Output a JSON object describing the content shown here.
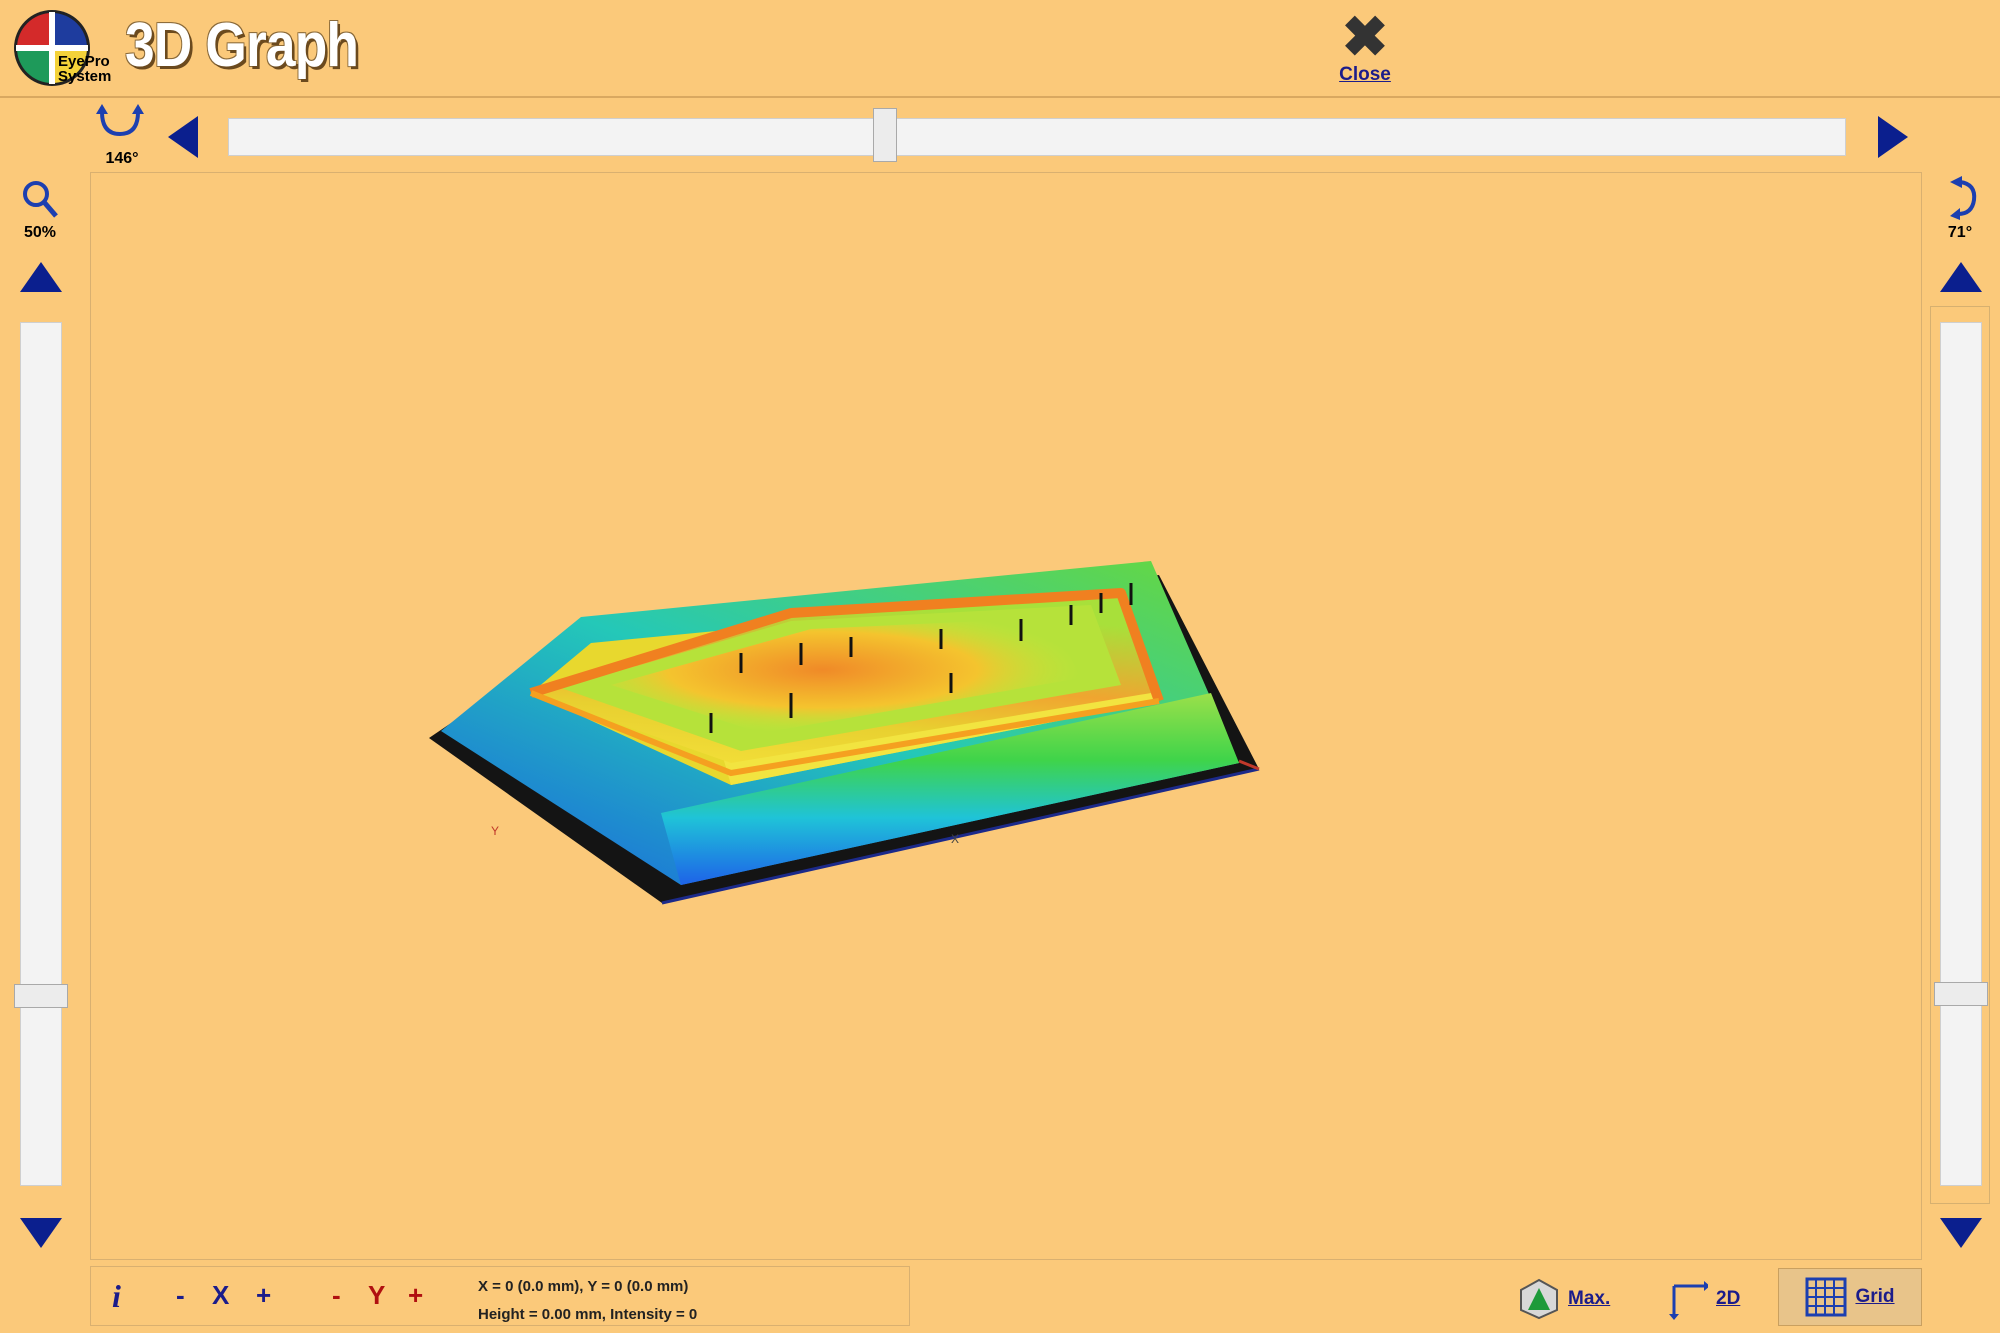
{
  "header": {
    "logo_text_line1": "EyePro",
    "logo_text_line2": "System",
    "title": "3D Graph",
    "close_label": "Close"
  },
  "rotation": {
    "horizontal_label": "146°",
    "vertical_label": "71°"
  },
  "zoom": {
    "label": "50%"
  },
  "bottom": {
    "info_glyph": "i",
    "x_minus": "-",
    "x_label": "X",
    "x_plus": "+",
    "y_minus": "-",
    "y_label": "Y",
    "y_plus": "+",
    "coords_line1": "X = 0 (0.0 mm), Y = 0 (0.0 mm)",
    "coords_line2": "Height = 0.00 mm, Intensity = 0"
  },
  "tools": {
    "max_label": "Max.",
    "view2d_label": "2D",
    "grid_label": "Grid"
  },
  "plot": {
    "axis_x_label": "X",
    "axis_y_label": "Y"
  },
  "icons": {
    "rotate_horizontal": "rotate-horizontal-icon",
    "rotate_vertical": "rotate-vertical-icon",
    "zoom": "magnifier-icon",
    "close": "close-icon",
    "max": "max-icon",
    "view2d": "2d-axes-icon",
    "grid": "grid-icon"
  },
  "colors": {
    "accent": "#0b1f8e",
    "background": "#fbc97a"
  }
}
